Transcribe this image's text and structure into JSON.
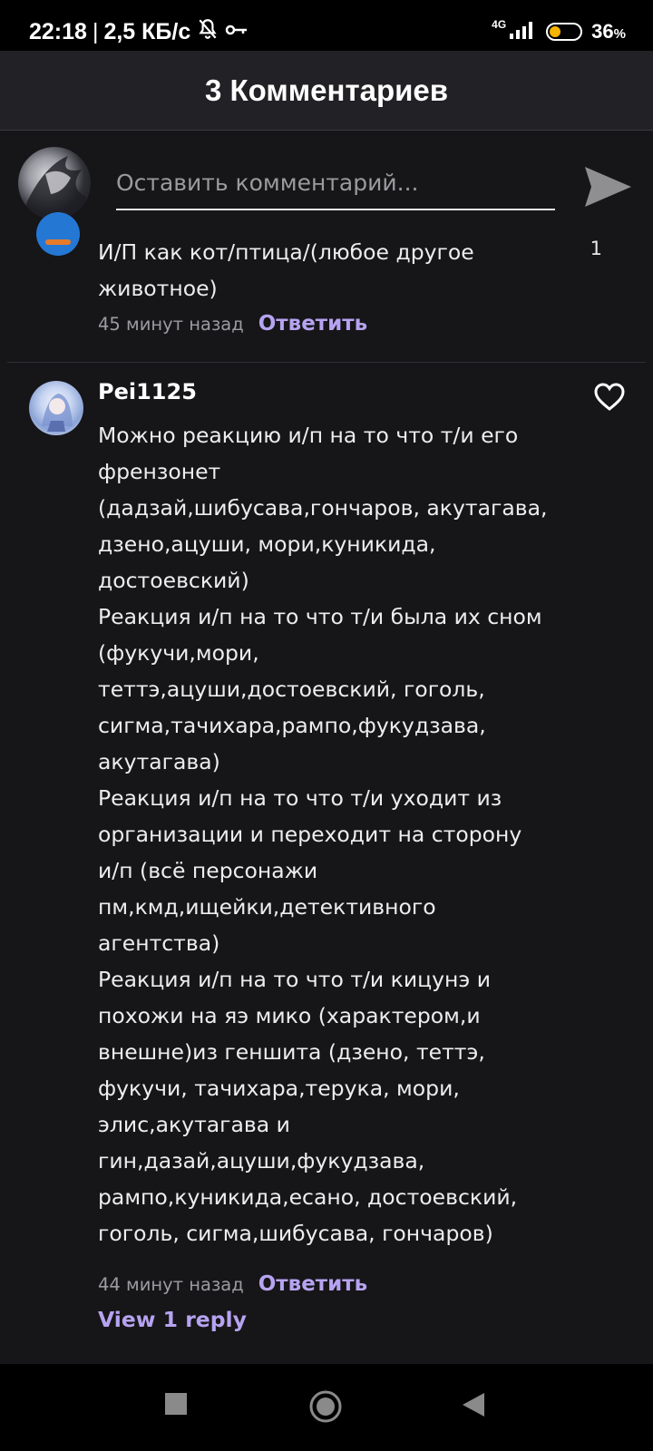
{
  "status_bar": {
    "time": "22:18",
    "separator": "|",
    "speed": "2,5 КБ/с",
    "network": "4G",
    "battery_percent": "36",
    "battery_suffix": "%",
    "battery_level": 0.36,
    "icons": [
      "bell-muted-icon",
      "key-icon",
      "signal-icon",
      "battery-icon"
    ]
  },
  "header": {
    "title": "3 Комментариев"
  },
  "compose": {
    "placeholder": "Оставить комментарий...",
    "icons": [
      "avatar",
      "send-icon"
    ]
  },
  "comments": [
    {
      "text": "И/П как кот/птица/(любое другое\nживотное)",
      "likes": "1",
      "time": "45 минут назад",
      "reply_label": "Ответить"
    },
    {
      "username": "Pei1125",
      "text": "Можно реакцию и/п на то что т/и его\nфрензонет\n(дадзай,шибусава,гончаров, акутагава,\nдзено,ацуши, мори,куникида,\nдостоевский)\nРеакция и/п на то что т/и была их сном\n(фукучи,мори,\nтеттэ,ацуши,достоевский, гоголь,\nсигма,тачихара,рампо,фукудзава,\nакутагава)\nРеакция и/п на то что т/и уходит из\nорганизации и переходит на сторону\nи/п (всё персонажи\nпм,кмд,ищейки,детективного\nагентства)\nРеакция и/п на то что т/и кицунэ и\nпохожи на яэ мико (характером,и\nвнешне)из геншита (дзено, теттэ,\nфукучи, тачихара,терука, мори,\nэлис,акутагава и\nгин,дазай,ацуши,фукудзава,\nрампо,куникида,есано, достоевский,\nгоголь, сигма,шибусава, гончаров)",
      "time": "44 минут назад",
      "reply_label": "Ответить",
      "view_replies": "View 1 reply"
    }
  ],
  "colors": {
    "accent": "#b6a3f0",
    "background": "#161518",
    "header": "#222125"
  },
  "nav": {
    "icons": [
      "recents-square-icon",
      "home-circle-icon",
      "back-triangle-icon"
    ]
  }
}
